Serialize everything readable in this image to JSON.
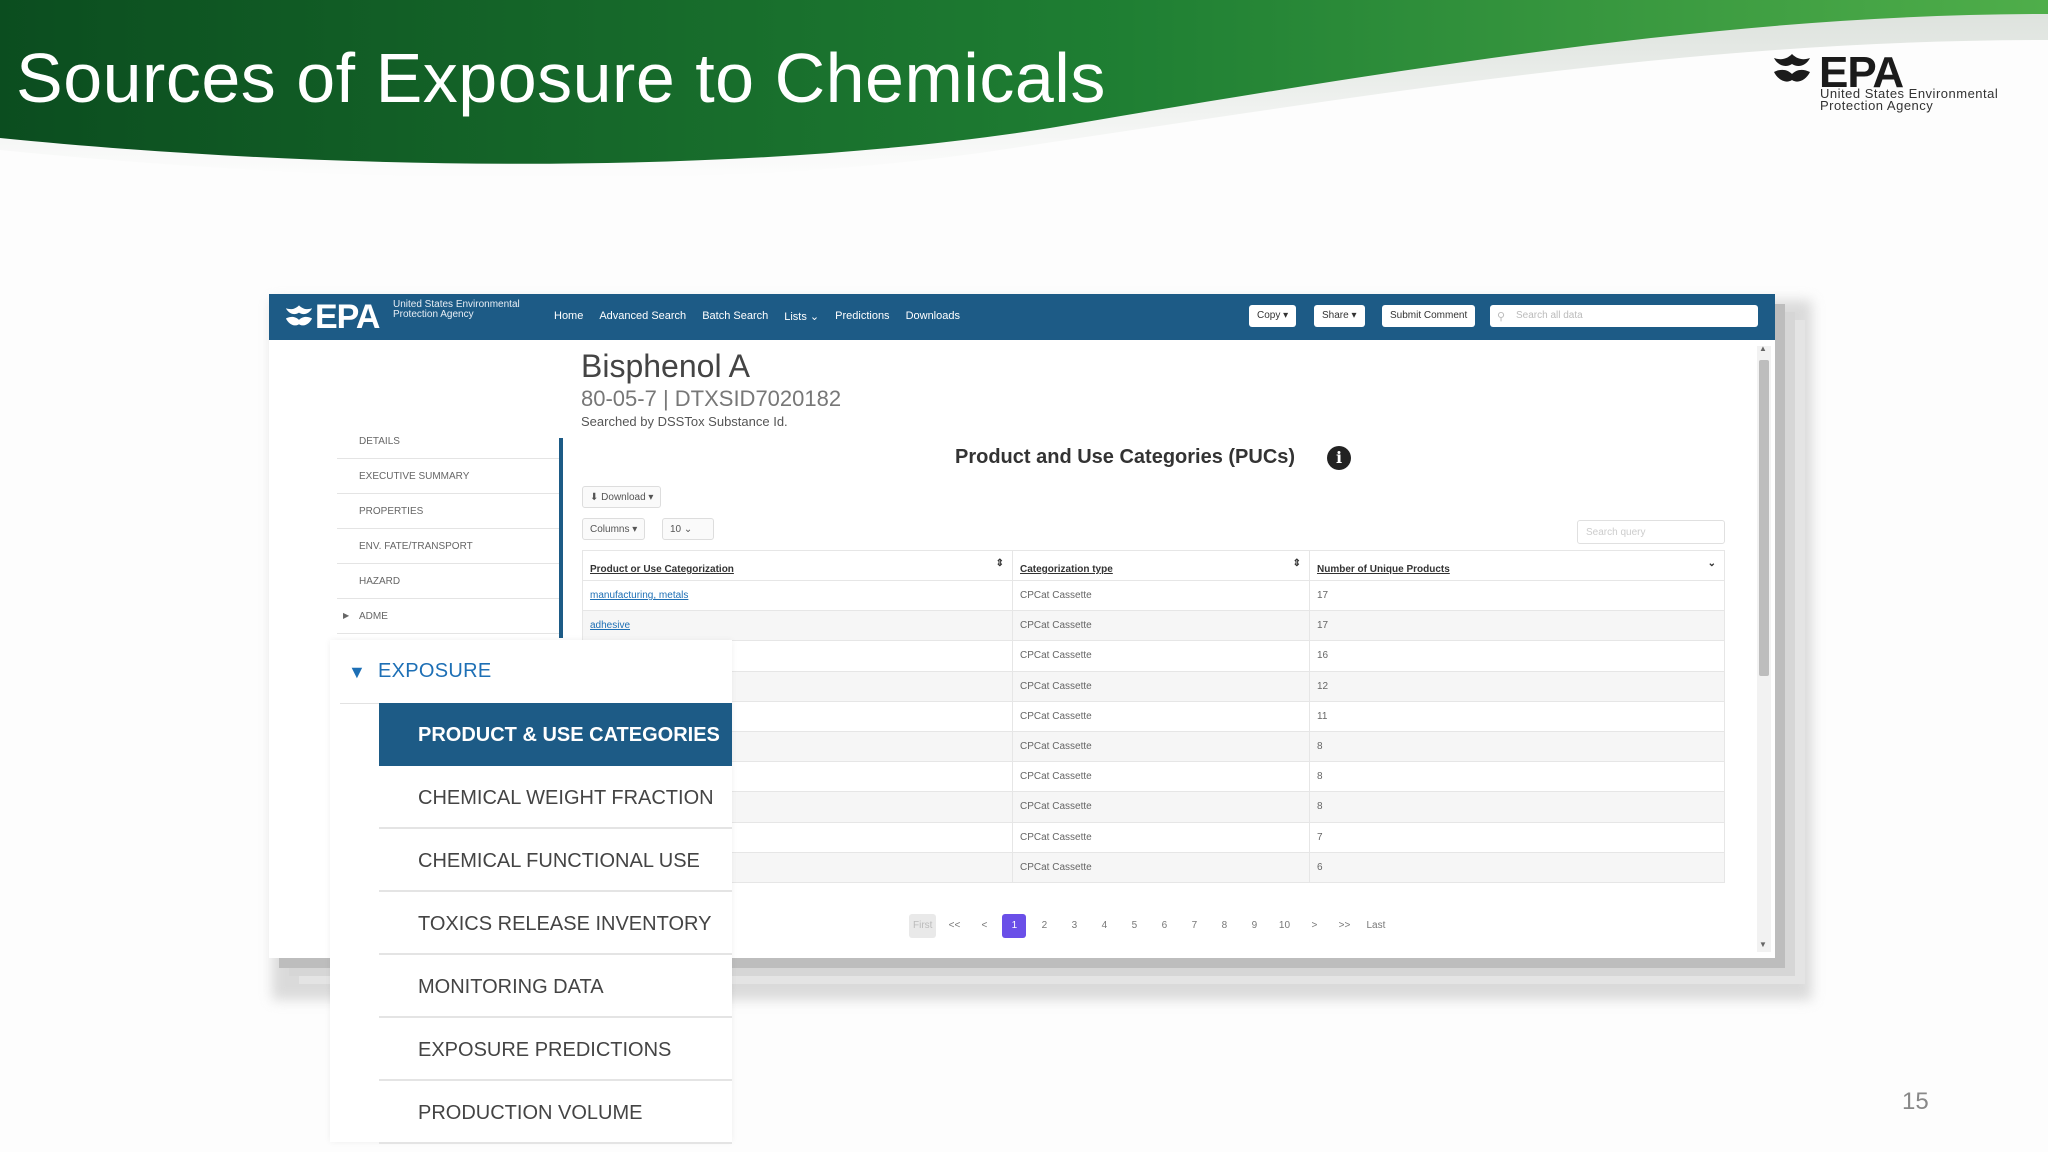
{
  "slide": {
    "title": "Sources of Exposure to Chemicals",
    "page_number": "15",
    "logo": {
      "text": "EPA",
      "subtitle": "United States Environmental Protection Agency"
    }
  },
  "app": {
    "logo": {
      "text": "EPA",
      "subtitle": "United States Environmental Protection Agency"
    },
    "nav_links": [
      "Home",
      "Advanced Search",
      "Batch Search",
      "Lists",
      "Predictions",
      "Downloads"
    ],
    "buttons": {
      "copy": "Copy",
      "share": "Share",
      "submit_comment": "Submit Comment"
    },
    "search_placeholder": "Search all data"
  },
  "chemical": {
    "name": "Bisphenol A",
    "ids": "80-05-7 | DTXSID7020182",
    "searched_by": "Searched by DSSTox Substance Id."
  },
  "sidebar": {
    "items": [
      "DETAILS",
      "EXECUTIVE SUMMARY",
      "PROPERTIES",
      "ENV. FATE/TRANSPORT",
      "HAZARD",
      "ADME"
    ]
  },
  "section": {
    "title": "Product and Use Categories (PUCs)",
    "download_label": "Download",
    "columns_label": "Columns",
    "page_size": "10",
    "table_search_placeholder": "Search query"
  },
  "table": {
    "headers": [
      "Product or Use Categorization",
      "Categorization type",
      "Number of Unique Products"
    ],
    "rows": [
      [
        "manufacturing, metals",
        "CPCat Cassette",
        "17"
      ],
      [
        "adhesive",
        "CPCat Cassette",
        "17"
      ],
      [
        "",
        "CPCat Cassette",
        "16"
      ],
      [
        "",
        "CPCat Cassette",
        "12"
      ],
      [
        "",
        "CPCat Cassette",
        "11"
      ],
      [
        "",
        "CPCat Cassette",
        "8"
      ],
      [
        "",
        "CPCat Cassette",
        "8"
      ],
      [
        "",
        "CPCat Cassette",
        "8"
      ],
      [
        "",
        "CPCat Cassette",
        "7"
      ],
      [
        "",
        "CPCat Cassette",
        "6"
      ]
    ]
  },
  "pagination": {
    "first": "First",
    "prev_prev": "<<",
    "prev": "<",
    "pages": [
      "1",
      "2",
      "3",
      "4",
      "5",
      "6",
      "7",
      "8",
      "9",
      "10"
    ],
    "active_page": "1",
    "next": ">",
    "next_next": ">>",
    "last": "Last"
  },
  "zoom_menu": {
    "header": "EXPOSURE",
    "items": [
      "PRODUCT & USE CATEGORIES",
      "CHEMICAL WEIGHT FRACTION",
      "CHEMICAL FUNCTIONAL USE",
      "TOXICS RELEASE INVENTORY",
      "MONITORING DATA",
      "EXPOSURE PREDICTIONS",
      "PRODUCTION VOLUME"
    ],
    "active_item": "PRODUCT & USE CATEGORIES"
  },
  "colors": {
    "header_green_dark": "#0e5a24",
    "header_green_light": "#2f9a3c",
    "nav_blue": "#1d5b86",
    "link_blue": "#1d6fb5",
    "active_page": "#6a4fe8"
  }
}
